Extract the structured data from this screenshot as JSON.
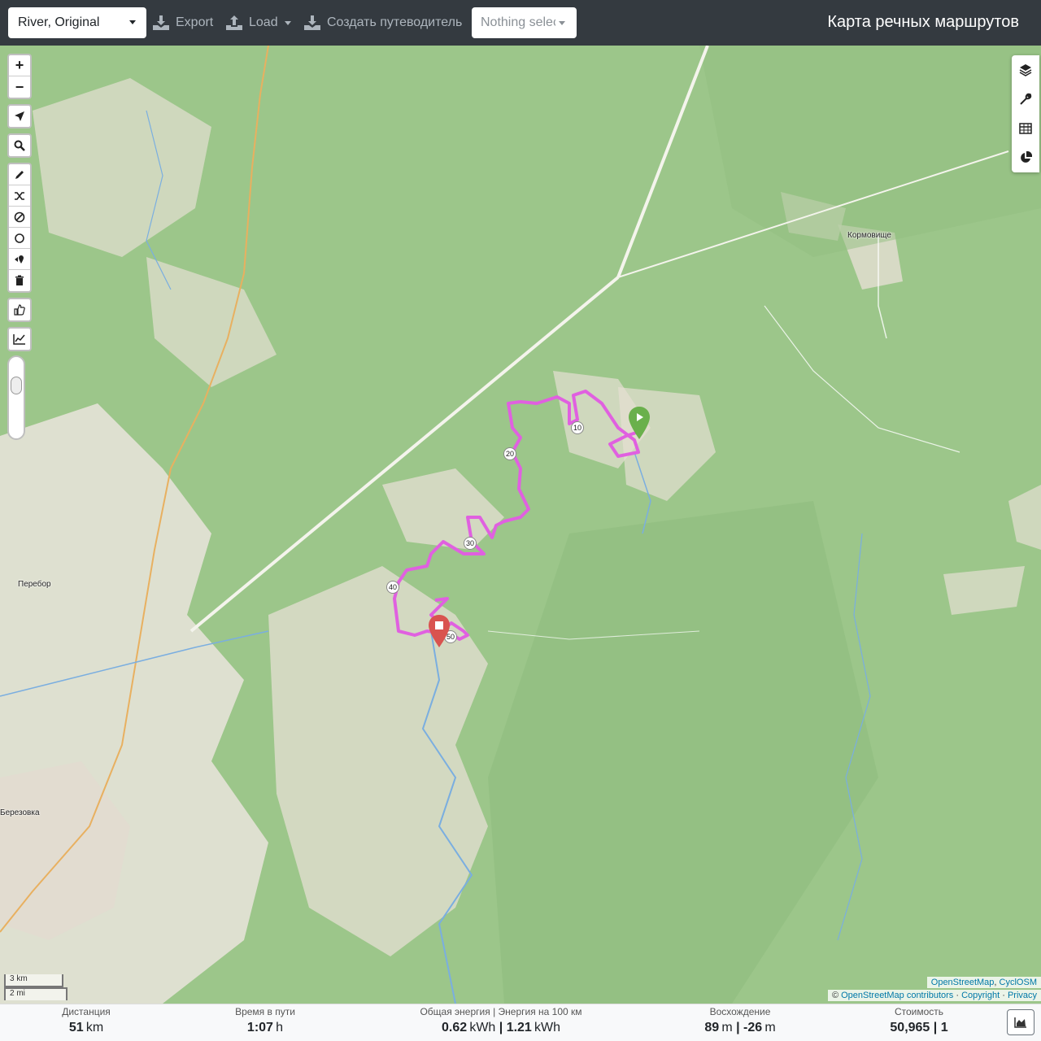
{
  "navbar": {
    "profile": "River, Original",
    "export_label": "Export",
    "load_label": "Load",
    "guide_label": "Создать путеводитель",
    "selection_label": "Nothing selected",
    "brand": "Карта речных маршрутов"
  },
  "map": {
    "places": {
      "kormovishche": "Кормовище",
      "perebor": "Перебор",
      "berezovka": "Березовка"
    },
    "route_markers": [
      "10",
      "20",
      "30",
      "40",
      "50"
    ],
    "route_color": "#e060e0",
    "forest_color": "#9cc68a",
    "open_land_color": "#eae4dc",
    "scale": {
      "km": "3 km",
      "mi": "2 mi"
    },
    "attribution": {
      "line1_a": "OpenStreetMap",
      "line1_sep": ", ",
      "line1_b": "CyclOSM",
      "line2_prefix": "© ",
      "line2_a": "OpenStreetMap contributors",
      "line2_b": "Copyright",
      "line2_c": "Privacy",
      "dot": " · "
    }
  },
  "left_toolbar": {
    "zoom_in": "+",
    "zoom_out": "−"
  },
  "stats": {
    "distance": {
      "label": "Дистанция",
      "value": "51",
      "unit": "km"
    },
    "time": {
      "label": "Время в пути",
      "value": "1:07",
      "unit": "h"
    },
    "energy": {
      "label": "Общая энергия | Энергия на 100 км",
      "value1": "0.62",
      "unit1": "kWh",
      "value2": "1.21",
      "unit2": "kWh"
    },
    "ascent": {
      "label": "Восхождение",
      "value1": "89",
      "unit1": "m",
      "value2": "-26",
      "unit2": "m"
    },
    "cost": {
      "label": "Стоимость",
      "value": "50,965 | 1"
    }
  }
}
